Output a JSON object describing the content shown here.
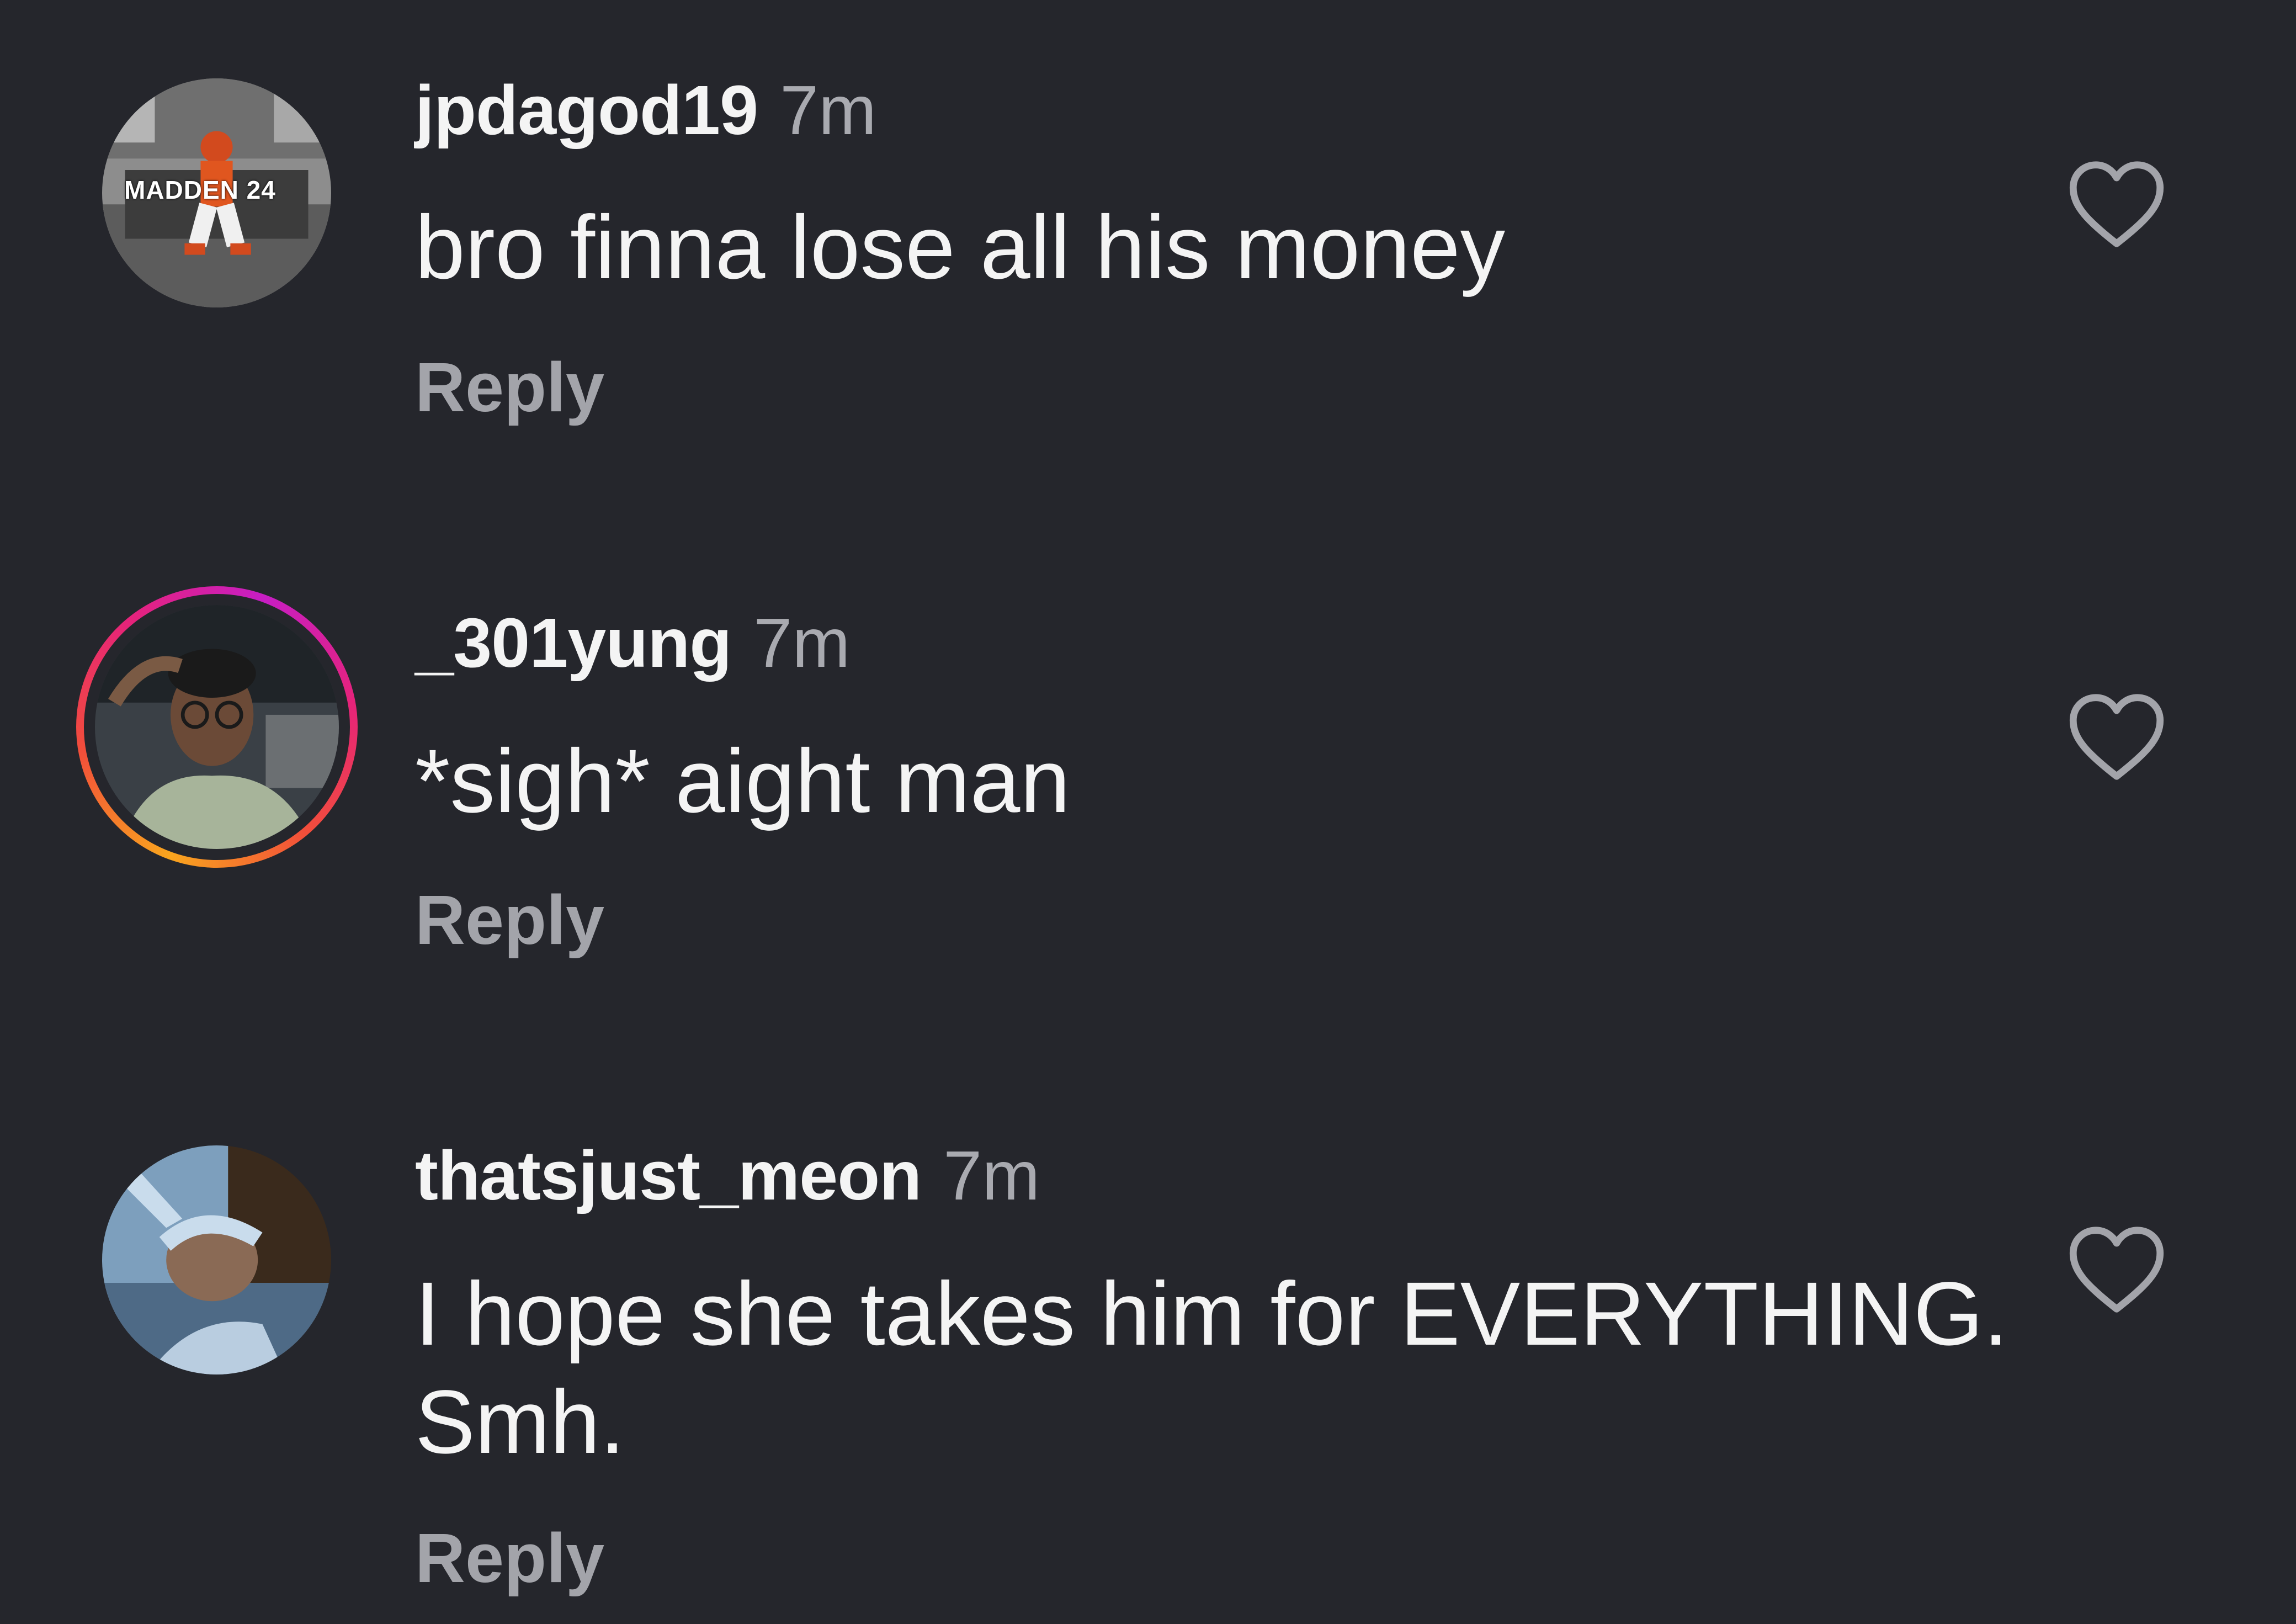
{
  "comments": [
    {
      "username": "jpdagod19",
      "time": "7m",
      "text": "bro finna lose all his money",
      "reply_label": "Reply",
      "avatar_badge": "MADDEN 24",
      "has_story_ring": false
    },
    {
      "username": "_301yung",
      "time": "7m",
      "text": "*sigh* aight man",
      "reply_label": "Reply",
      "has_story_ring": true
    },
    {
      "username": "thatsjust_meon",
      "time": "7m",
      "text": "I hope she takes him for EVERYTHING. Smh.",
      "reply_label": "Reply",
      "has_story_ring": false
    }
  ],
  "icons": {
    "like": "heart-outline-icon"
  },
  "colors": {
    "background": "#25262c",
    "text_primary": "#f4f4f4",
    "text_secondary": "#a9aab0",
    "story_ring_start": "#f9a51e",
    "story_ring_end": "#c71ec4"
  }
}
